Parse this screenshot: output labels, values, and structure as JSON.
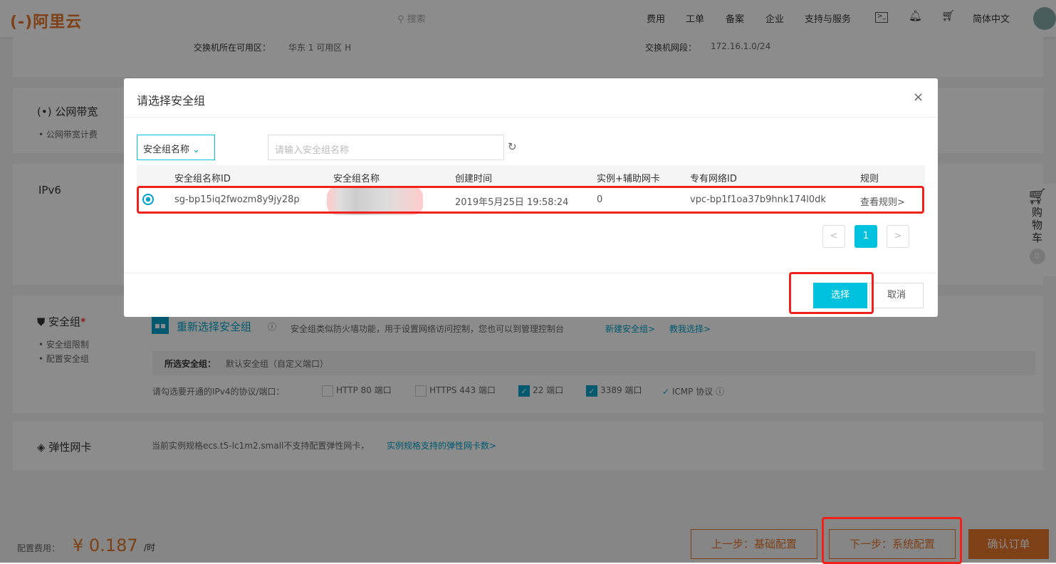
{
  "header": {
    "logo": "(-)阿里云",
    "search_placeholder": "搜索",
    "nav": [
      "费用",
      "工单",
      "备案",
      "企业",
      "支持与服务"
    ],
    "language": "简体中文"
  },
  "network": {
    "zone_label": "交换机所在可用区：",
    "zone_value": "华东 1 可用区 H",
    "cidr_label": "交换机网段：",
    "cidr_value": "172.16.1.0/24"
  },
  "bandwidth": {
    "title": "公网带宽",
    "sub": "公网带宽计费"
  },
  "ipv6": {
    "title": "IPv6"
  },
  "security": {
    "title": "安全组",
    "required": "*",
    "subs": [
      "安全组限制",
      "配置安全组"
    ],
    "reselect": "重新选择安全组",
    "desc": "安全组类似防火墙功能，用于设置网络访问控制，您也可以到管理控制台",
    "new_link": "新建安全组>",
    "help_link": "教我选择>",
    "selected_label": "所选安全组：",
    "selected_value": "默认安全组（自定义端口）",
    "ports_label": "请勾选要开通的IPv4的协议/端口：",
    "ports": [
      {
        "label": "HTTP 80 端口",
        "checked": false
      },
      {
        "label": "HTTPS 443 端口",
        "checked": false
      },
      {
        "label": "22 端口",
        "checked": true
      },
      {
        "label": "3389 端口",
        "checked": true
      }
    ],
    "icmp": "ICMP 协议"
  },
  "eni": {
    "title": "弹性网卡",
    "desc": "当前实例规格ecs.t5-lc1m2.small不支持配置弹性网卡，",
    "link": "实例规格支持的弹性网卡数>"
  },
  "cart": {
    "label": "购物车",
    "count": "0"
  },
  "footer": {
    "cost_label": "配置费用：",
    "price": "¥ 0.187",
    "unit": "/时",
    "prev": "上一步：基础配置",
    "next": "下一步：系统配置",
    "confirm": "确认订单"
  },
  "dialog": {
    "title": "请选择安全组",
    "filter": "安全组名称",
    "search_placeholder": "请输入安全组名称",
    "columns": [
      "安全组名称ID",
      "安全组名称",
      "创建时间",
      "实例+辅助网卡",
      "专有网络ID",
      "规则"
    ],
    "rows": [
      {
        "id": "sg-bp15iq2fwozm8y9jy28p",
        "name": "",
        "created": "2019年5月25日 19:58:24",
        "instances": "0",
        "vpc": "vpc-bp1f1oa37b9hnk174l0dk",
        "rule": "查看规则>"
      }
    ],
    "page": "1",
    "prev": "<",
    "next": ">",
    "select": "选择",
    "cancel": "取消"
  }
}
